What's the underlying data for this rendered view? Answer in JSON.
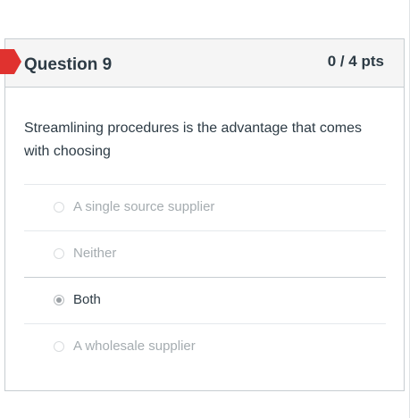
{
  "question": {
    "title": "Question 9",
    "points": "0 / 4 pts",
    "status": "incorrect",
    "text": "Streamlining procedures is the advantage that comes with choosing"
  },
  "answers": [
    {
      "label": "A single source supplier",
      "selected": false
    },
    {
      "label": "Neither",
      "selected": false
    },
    {
      "label": "Both",
      "selected": true
    },
    {
      "label": "A wholesale supplier",
      "selected": false
    }
  ],
  "colors": {
    "incorrect_flag": "#e0322f",
    "text": "#2d3b45",
    "muted_text": "#a5acb0",
    "header_bg": "#f5f5f5"
  }
}
